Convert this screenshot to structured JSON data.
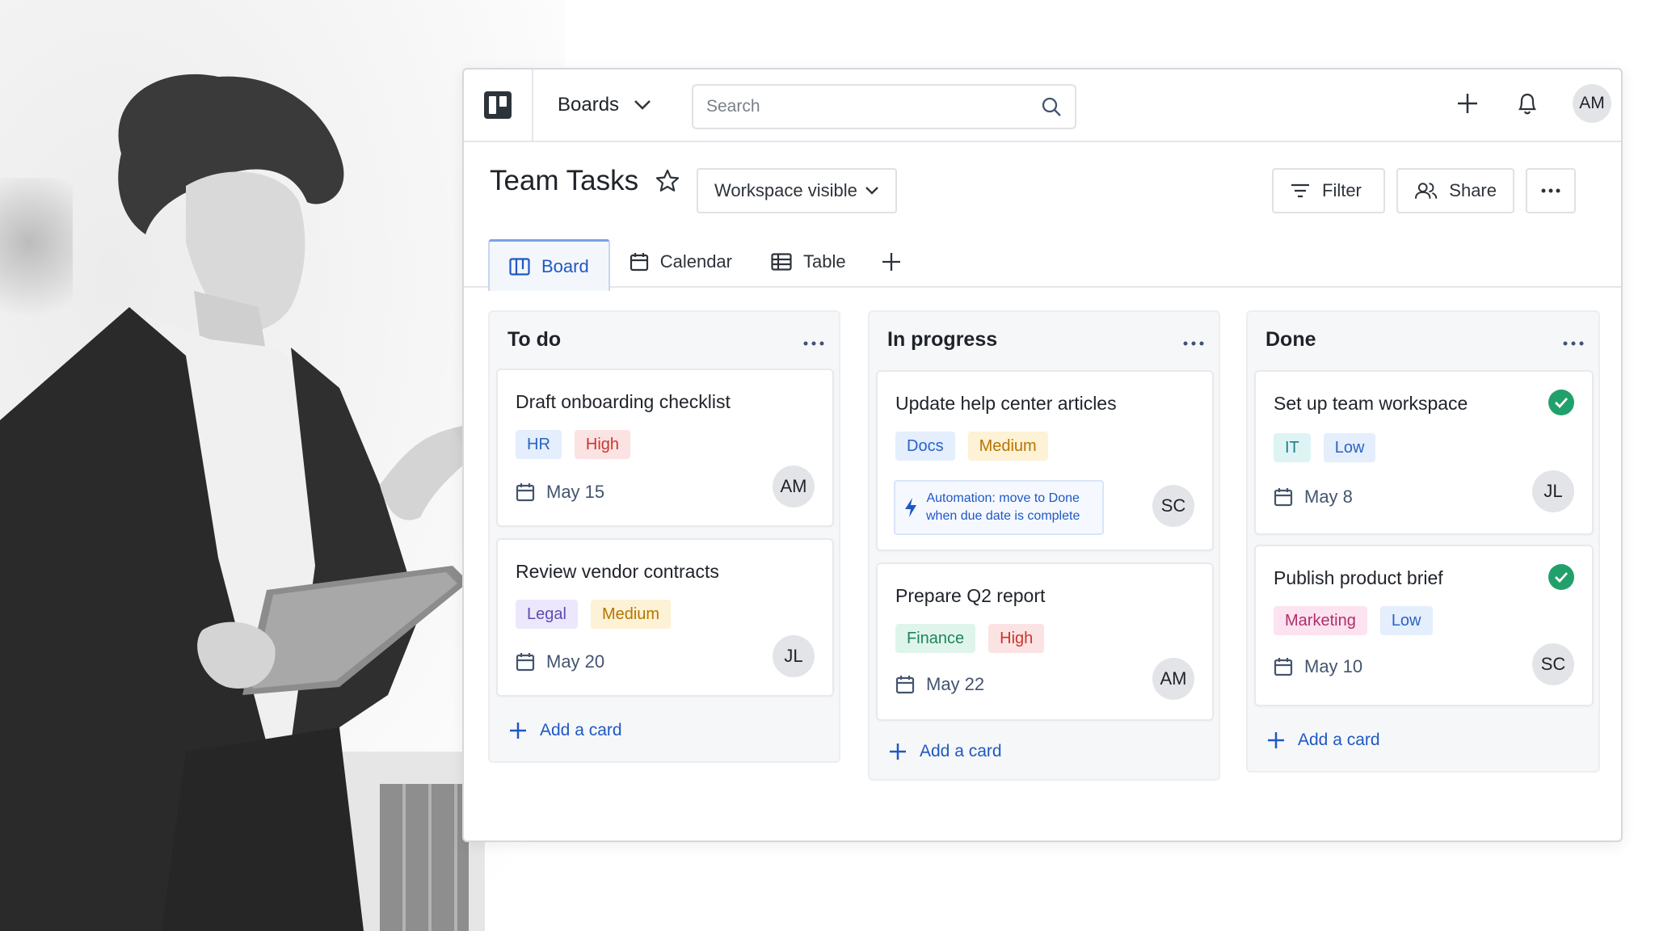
{
  "topbar": {
    "boards_label": "Boards",
    "search_placeholder": "Search",
    "user_initials": "AM"
  },
  "board": {
    "title": "Team Tasks",
    "visibility_label": "Workspace visible",
    "filter_label": "Filter",
    "share_label": "Share"
  },
  "tabs": [
    {
      "label": "Board",
      "active": true
    },
    {
      "label": "Calendar",
      "active": false
    },
    {
      "label": "Table",
      "active": false
    }
  ],
  "columns": [
    {
      "title": "To do",
      "add_label": "Add a card",
      "cards": [
        {
          "title": "Draft onboarding checklist",
          "tags": [
            "HR",
            "High"
          ],
          "due": "May 15",
          "assignee": "AM"
        },
        {
          "title": "Review vendor contracts",
          "tags": [
            "Legal",
            "Medium"
          ],
          "due": "May 20",
          "assignee": "JL"
        }
      ]
    },
    {
      "title": "In progress",
      "add_label": "Add a card",
      "cards": [
        {
          "title": "Update help center articles",
          "tags": [
            "Docs",
            "Medium"
          ],
          "automation_line1": "Automation: move to Done",
          "automation_line2": "when due date is complete",
          "assignee": "SC"
        },
        {
          "title": "Prepare Q2 report",
          "tags": [
            "Finance",
            "High"
          ],
          "due": "May 22",
          "assignee": "AM"
        }
      ]
    },
    {
      "title": "Done",
      "add_label": "Add a card",
      "cards": [
        {
          "title": "Set up team workspace",
          "tags": [
            "IT",
            "Low"
          ],
          "due": "May 8",
          "assignee": "JL",
          "completed": true
        },
        {
          "title": "Publish product brief",
          "tags": [
            "Marketing",
            "Low"
          ],
          "due": "May 10",
          "assignee": "SC",
          "completed": true
        }
      ]
    }
  ],
  "colors": {
    "accent": "#1f58c4",
    "complete": "#22a06b"
  }
}
